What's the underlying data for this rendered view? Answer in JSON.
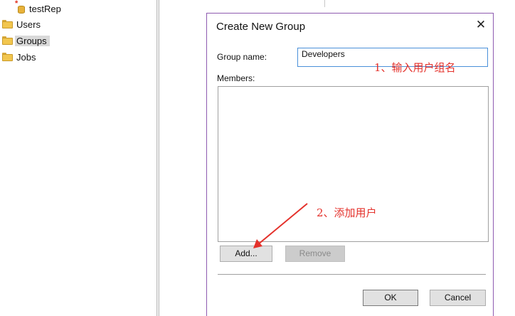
{
  "tree": {
    "items": [
      {
        "label": "testRep",
        "icon": "repository-icon"
      },
      {
        "label": "Users",
        "icon": "folder-icon"
      },
      {
        "label": "Groups",
        "icon": "folder-icon",
        "selected": true
      },
      {
        "label": "Jobs",
        "icon": "folder-icon"
      }
    ]
  },
  "dialog": {
    "title": "Create New Group",
    "close_glyph": "✕",
    "group_name_label": "Group name:",
    "group_name_value": "Developers",
    "members_label": "Members:",
    "add_label": "Add...",
    "remove_label": "Remove",
    "ok_label": "OK",
    "cancel_label": "Cancel"
  },
  "annotations": {
    "step1": "1、输入用户组名",
    "step2": "2、添加用户"
  },
  "colors": {
    "annotation": "#e4312b",
    "dialog_border": "#8e5bb0",
    "input_focus": "#4a90d9",
    "folder": "#f2c64e"
  }
}
